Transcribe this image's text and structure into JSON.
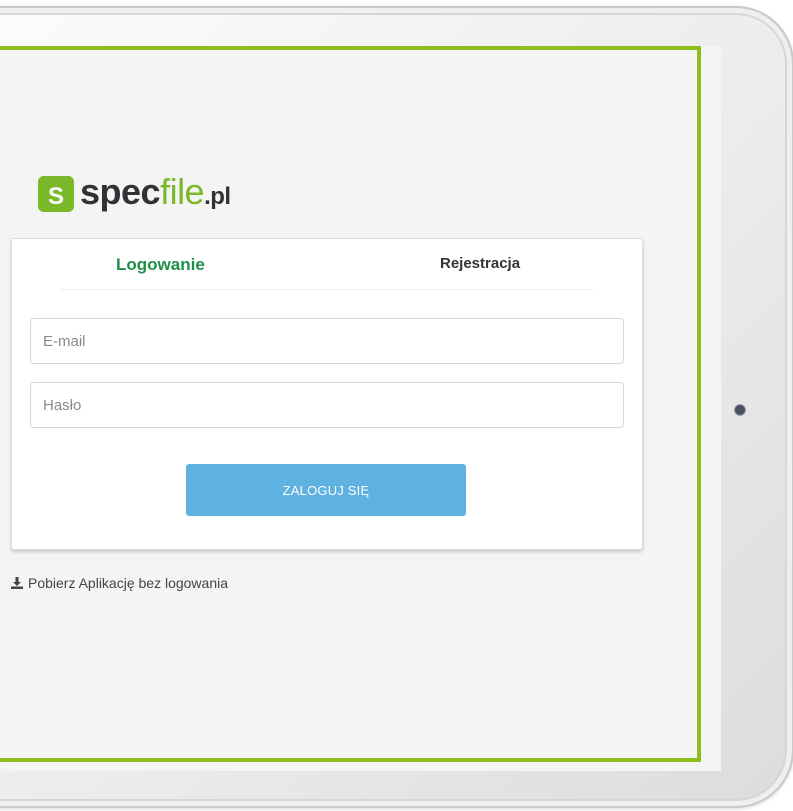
{
  "logo": {
    "mark_letter": "S",
    "text_spec": "spec",
    "text_file": "file",
    "text_tld": ".pl",
    "brand_green": "#7cb92a"
  },
  "tabs": [
    {
      "label": "Logowanie",
      "active": true
    },
    {
      "label": "Rejestracja",
      "active": false
    }
  ],
  "form": {
    "email_placeholder": "E-mail",
    "email_value": "",
    "password_placeholder": "Hasło",
    "password_value": "",
    "submit_label": "ZALOGUJ SIĘ",
    "submit_color": "#5fb2e0"
  },
  "download_link": {
    "icon": "download-icon",
    "label": "Pobierz Aplikację bez logowania"
  },
  "colors": {
    "screen_border": "#8cbf1e",
    "active_tab": "#1f8f48"
  }
}
